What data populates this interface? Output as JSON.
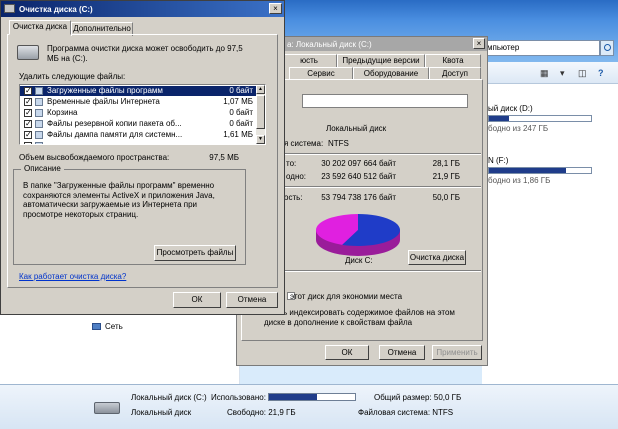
{
  "explorer": {
    "address_fragment": "мпьютер",
    "drives": [
      {
        "name": "ый диск (D:)",
        "free": "бодно из 247 ГБ",
        "used_fraction": 0.2
      },
      {
        "name": "N (F:)",
        "free": "бодно из 1,86 ГБ",
        "used_fraction": 0.75
      }
    ],
    "nav_network": "Сеть",
    "icons": {
      "search": "search-icon",
      "view": "view-options-icon",
      "help": "help-icon"
    }
  },
  "status_bar": {
    "drive_name": "Локальный диск (C:)",
    "drive_type": "Локальный диск",
    "used_label": "Использовано:",
    "used_fraction": 0.56,
    "free_label": "Свободно: 21,9 ГБ",
    "total_label": "Общий размер: 50,0 ГБ",
    "fs_label": "Файловая система: NTFS"
  },
  "properties": {
    "title": "а: Локальный диск (C:)",
    "tabs_row1": [
      "юсть",
      "Предыдущие версии",
      "Квота"
    ],
    "tabs_row2": [
      "Сервис",
      "Оборудование",
      "Доступ"
    ],
    "type_value": "Локальный диск",
    "fs_label": "я система:",
    "fs_value": "NTFS",
    "used": {
      "label": "то:",
      "bytes": "30 202 097 664 байт",
      "gb": "28,1 ГБ"
    },
    "free": {
      "label": "одно:",
      "bytes": "23 592 640 512 байт",
      "gb": "21,9 ГБ"
    },
    "capacity": {
      "label": "ость:",
      "bytes": "53 794 738 176 байт",
      "gb": "50,0 ГБ"
    },
    "disk_label": "Диск C:",
    "cleanup_button": "Очистка диска",
    "compress_label": "этот диск для экономии места",
    "index_label_1": "ешить индексировать содержимое файлов на этом",
    "index_label_2": "диске в дополнение к свойствам файла",
    "ok": "ОК",
    "cancel": "Отмена",
    "apply": "Применить",
    "colors": {
      "used": "#1f3cc8",
      "free": "#e020e0"
    }
  },
  "cleanup": {
    "title": "Очистка диска  (C:)",
    "tabs": [
      "Очистка диска",
      "Дополнительно"
    ],
    "intro": "Программа очистки диска может освободить до 97,5 МБ на  (C:).",
    "files_label": "Удалить следующие файлы:",
    "files": [
      {
        "name": "Загруженные файлы программ",
        "size": "0 байт",
        "checked": true,
        "selected": true
      },
      {
        "name": "Временные файлы Интернета",
        "size": "1,07 МБ",
        "checked": true,
        "selected": false
      },
      {
        "name": "Корзина",
        "size": "0 байт",
        "checked": true,
        "selected": false
      },
      {
        "name": "Файлы резервной копии пакета об...",
        "size": "0 байт",
        "checked": true,
        "selected": false
      },
      {
        "name": "Файлы дампа памяти для системн...",
        "size": "1,61 МБ",
        "checked": true,
        "selected": false
      },
      {
        "name": "",
        "size": "",
        "checked": false,
        "selected": false
      }
    ],
    "space_label": "Объем высвобождаемого пространства:",
    "space_value": "97,5 МБ",
    "description_legend": "Описание",
    "description": "В папке \"Загруженные файлы программ\" временно сохраняются элементы ActiveX и приложения Java, автоматически загружаемые из Интернета при просмотре некоторых страниц.",
    "view_files": "Просмотреть файлы",
    "help_link": "Как работает очистка диска?",
    "ok": "ОК",
    "cancel": "Отмена",
    "close_glyph": "×"
  }
}
